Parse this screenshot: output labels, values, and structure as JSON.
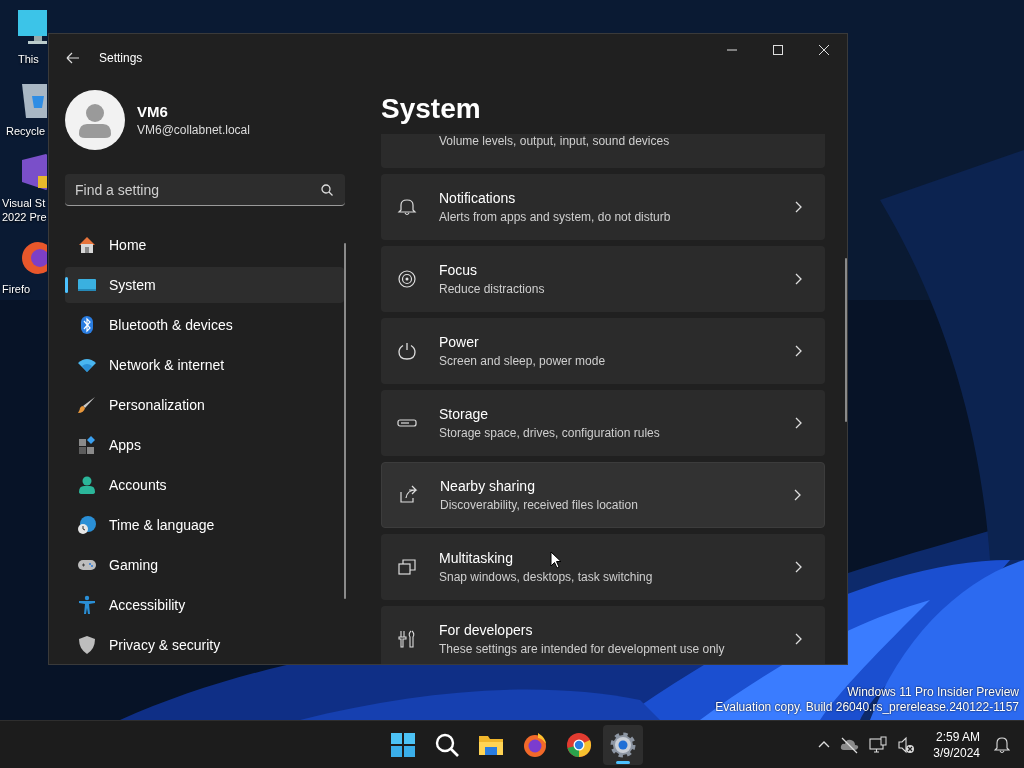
{
  "desktop": {
    "icons": [
      {
        "lines": [
          "This"
        ]
      },
      {
        "lines": [
          "Recycle"
        ]
      },
      {
        "lines": [
          "Visual St",
          "2022 Pre"
        ]
      },
      {
        "lines": [
          "Firefo"
        ]
      }
    ],
    "watermark": [
      "Windows 11 Pro Insider Preview",
      "Evaluation copy. Build 26040.rs_prerelease.240122-1157"
    ]
  },
  "window": {
    "title": "Settings",
    "profile": {
      "name": "VM6",
      "email": "VM6@collabnet.local"
    },
    "search": {
      "placeholder": "Find a setting"
    },
    "nav": [
      {
        "label": "Home",
        "selected": false
      },
      {
        "label": "System",
        "selected": true
      },
      {
        "label": "Bluetooth & devices",
        "selected": false
      },
      {
        "label": "Network & internet",
        "selected": false
      },
      {
        "label": "Personalization",
        "selected": false
      },
      {
        "label": "Apps",
        "selected": false
      },
      {
        "label": "Accounts",
        "selected": false
      },
      {
        "label": "Time & language",
        "selected": false
      },
      {
        "label": "Gaming",
        "selected": false
      },
      {
        "label": "Accessibility",
        "selected": false
      },
      {
        "label": "Privacy & security",
        "selected": false
      }
    ],
    "page_title": "System",
    "cards": [
      {
        "kind": "partial",
        "description": "Volume levels, output, input, sound devices"
      },
      {
        "kind": "full",
        "title": "Notifications",
        "description": "Alerts from apps and system, do not disturb",
        "selected": false
      },
      {
        "kind": "full",
        "title": "Focus",
        "description": "Reduce distractions",
        "selected": false
      },
      {
        "kind": "full",
        "title": "Power",
        "description": "Screen and sleep, power mode",
        "selected": false
      },
      {
        "kind": "full",
        "title": "Storage",
        "description": "Storage space, drives, configuration rules",
        "selected": false
      },
      {
        "kind": "full",
        "title": "Nearby sharing",
        "description": "Discoverability, received files location",
        "selected": true
      },
      {
        "kind": "full",
        "title": "Multitasking",
        "description": "Snap windows, desktops, task switching",
        "selected": false
      },
      {
        "kind": "full",
        "title": "For developers",
        "description": "These settings are intended for development use only",
        "selected": false
      }
    ]
  },
  "taskbar": {
    "apps": [
      {
        "kind": "start",
        "selected": false
      },
      {
        "kind": "search",
        "selected": false
      },
      {
        "kind": "explorer",
        "selected": false
      },
      {
        "kind": "firefox",
        "selected": false
      },
      {
        "kind": "chrome",
        "selected": false
      },
      {
        "kind": "settings",
        "selected": true
      }
    ],
    "clock": {
      "time": "2:59 AM",
      "date": "3/9/2024"
    }
  }
}
